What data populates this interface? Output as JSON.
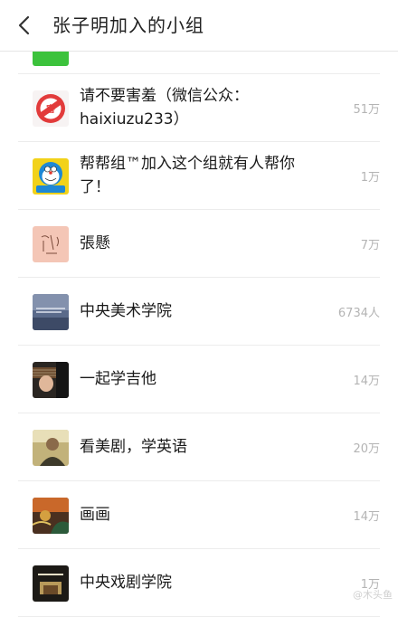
{
  "header": {
    "back_icon": "back-arrow-icon",
    "title": "张子明加入的小组"
  },
  "groups": [
    {
      "name": "",
      "count": "",
      "avatar": "green-group-avatar",
      "color": "#3cc23c"
    },
    {
      "name": "请不要害羞（微信公众：haixiuzu233）",
      "count": "51万",
      "avatar": "no-shy-sign-avatar"
    },
    {
      "name": "帮帮组™加入这个组就有人帮你了！",
      "count": "1万",
      "avatar": "cartoon-robot-cat-avatar"
    },
    {
      "name": "張懸",
      "count": "7万",
      "avatar": "handwriting-avatar"
    },
    {
      "name": "中央美术学院",
      "count": "6734人",
      "avatar": "academy-photo-avatar"
    },
    {
      "name": "一起学吉他",
      "count": "14万",
      "avatar": "guitar-photo-avatar"
    },
    {
      "name": "看美剧，学英语",
      "count": "20万",
      "avatar": "tv-actor-photo-avatar"
    },
    {
      "name": "画画",
      "count": "14万",
      "avatar": "painting-avatar"
    },
    {
      "name": "中央戏剧学院",
      "count": "1万",
      "avatar": "drama-academy-avatar"
    }
  ],
  "watermark": "@木头鱼"
}
